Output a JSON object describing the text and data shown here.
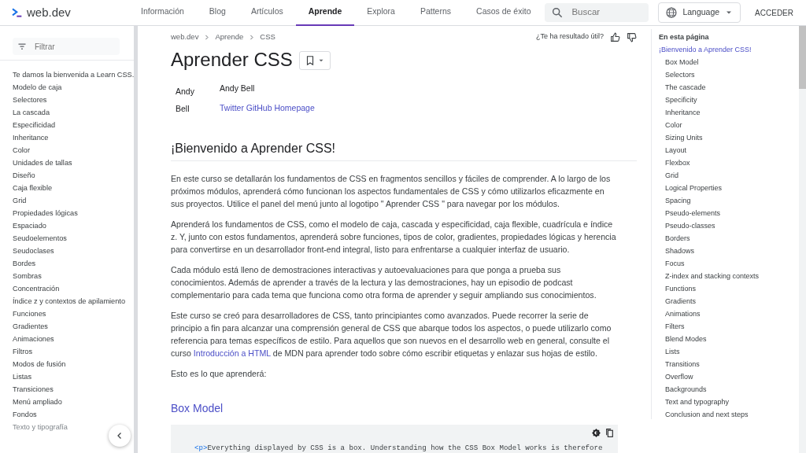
{
  "header": {
    "logo": "web.dev",
    "tabs": [
      {
        "label": "Información",
        "selected": false
      },
      {
        "label": "Blog",
        "selected": false
      },
      {
        "label": "Artículos",
        "selected": false
      },
      {
        "label": "Aprende",
        "selected": true
      },
      {
        "label": "Explora",
        "selected": false
      },
      {
        "label": "Patterns",
        "selected": false
      },
      {
        "label": "Casos de éxito",
        "selected": false
      }
    ],
    "search": {
      "placeholder": "Buscar"
    },
    "language": "Language",
    "signin": "ACCEDER"
  },
  "sidebar": {
    "filter": {
      "placeholder": "Filtrar"
    },
    "items": [
      {
        "label": "Te damos la bienvenida a Learn CSS.",
        "faded": false
      },
      {
        "label": "Modelo de caja",
        "faded": false
      },
      {
        "label": "Selectores",
        "faded": false
      },
      {
        "label": "La cascada",
        "faded": false
      },
      {
        "label": "Especificidad",
        "faded": false
      },
      {
        "label": "Inheritance",
        "faded": false
      },
      {
        "label": "Color",
        "faded": false
      },
      {
        "label": "Unidades de tallas",
        "faded": false
      },
      {
        "label": "Diseño",
        "faded": false
      },
      {
        "label": "Caja flexible",
        "faded": false
      },
      {
        "label": "Grid",
        "faded": false
      },
      {
        "label": "Propiedades lógicas",
        "faded": false
      },
      {
        "label": "Espaciado",
        "faded": false
      },
      {
        "label": "Seudoelementos",
        "faded": false
      },
      {
        "label": "Seudoclases",
        "faded": false
      },
      {
        "label": "Bordes",
        "faded": false
      },
      {
        "label": "Sombras",
        "faded": false
      },
      {
        "label": "Concentración",
        "faded": false
      },
      {
        "label": "Índice z y contextos de apilamiento",
        "faded": false
      },
      {
        "label": "Funciones",
        "faded": false
      },
      {
        "label": "Gradientes",
        "faded": false
      },
      {
        "label": "Animaciones",
        "faded": false
      },
      {
        "label": "Filtros",
        "faded": false
      },
      {
        "label": "Modos de fusión",
        "faded": false
      },
      {
        "label": "Listas",
        "faded": false
      },
      {
        "label": "Transiciones",
        "faded": false
      },
      {
        "label": "Menú ampliado",
        "faded": false
      },
      {
        "label": "Fondos",
        "faded": false
      },
      {
        "label": "Texto y tipografía",
        "faded": true
      }
    ]
  },
  "breadcrumbs": [
    "web.dev",
    "Aprende",
    "CSS"
  ],
  "feedback": "¿Te ha resultado útil?",
  "title": "Aprender CSS",
  "author": {
    "image_alt": "Andy Bell",
    "name": "Andy Bell",
    "links": "Twitter GitHub Homepage"
  },
  "section_heading": "¡Bienvenido a Aprender CSS!",
  "paragraphs": [
    [
      {
        "kind": "text",
        "text": "En este curso se detallarán los fundamentos de CSS en fragmentos sencillos y fáciles de comprender. A lo largo de los próximos módulos, aprenderá cómo funcionan los aspectos fundamentales de CSS y cómo utilizarlos eficazmente en sus proyectos. Utilice el panel del menú junto al logotipo \" Aprender CSS \" para navegar por los módulos."
      }
    ],
    [
      {
        "kind": "text",
        "text": "Aprenderá los fundamentos de CSS, como el modelo de caja, cascada y especificidad, caja flexible, cuadrícula e índice z. Y, junto con estos fundamentos, aprenderá sobre funciones, tipos de color, gradientes, propiedades lógicas y herencia para convertirse en un desarrollador front-end integral, listo para enfrentarse a cualquier interfaz de usuario."
      }
    ],
    [
      {
        "kind": "text",
        "text": "Cada módulo está lleno de demostraciones interactivas y autoevaluaciones para que ponga a prueba sus conocimientos. Además de aprender a través de la lectura y las demostraciones, hay un episodio de podcast complementario para cada tema que funciona como otra forma de aprender y seguir ampliando sus conocimientos."
      }
    ],
    [
      {
        "kind": "text",
        "text": "Este curso se creó para desarrolladores de CSS, tanto principiantes como avanzados. Puede recorrer la serie de principio a fin para alcanzar una comprensión general de CSS que abarque todos los aspectos, o puede utilizarlo como referencia para temas específicos de estilo. Para aquellos que son nuevos en el desarrollo web en general, consulte el curso "
      },
      {
        "kind": "link",
        "text": "Introducción a HTML"
      },
      {
        "kind": "text",
        "text": " de MDN para aprender todo sobre cómo escribir etiquetas y enlazar sus hojas de estilo."
      }
    ],
    [
      {
        "kind": "text",
        "text": "Esto es lo que aprenderá:"
      }
    ]
  ],
  "subheading": "Box Model",
  "code": {
    "tag": "<p>",
    "text": "Everything displayed by CSS is a box. Understanding how the CSS Box Model works is therefore"
  },
  "toc": {
    "title": "En esta página",
    "items": [
      {
        "label": "¡Bienvenido a Aprender CSS!",
        "selected": true,
        "children": [
          {
            "label": "Box Model",
            "selected": false
          },
          {
            "label": "Selectors",
            "selected": false
          },
          {
            "label": "The cascade",
            "selected": false
          },
          {
            "label": "Specificity",
            "selected": false
          },
          {
            "label": "Inheritance",
            "selected": false
          },
          {
            "label": "Color",
            "selected": false
          },
          {
            "label": "Sizing Units",
            "selected": false
          },
          {
            "label": "Layout",
            "selected": false
          },
          {
            "label": "Flexbox",
            "selected": false
          },
          {
            "label": "Grid",
            "selected": false
          },
          {
            "label": "Logical Properties",
            "selected": false
          },
          {
            "label": "Spacing",
            "selected": false
          },
          {
            "label": "Pseudo-elements",
            "selected": false
          },
          {
            "label": "Pseudo-classes",
            "selected": false
          },
          {
            "label": "Borders",
            "selected": false
          },
          {
            "label": "Shadows",
            "selected": false
          },
          {
            "label": "Focus",
            "selected": false
          },
          {
            "label": "Z-index and stacking contexts",
            "selected": false
          },
          {
            "label": "Functions",
            "selected": false
          },
          {
            "label": "Gradients",
            "selected": false
          },
          {
            "label": "Animations",
            "selected": false
          },
          {
            "label": "Filters",
            "selected": false
          },
          {
            "label": "Blend Modes",
            "selected": false
          },
          {
            "label": "Lists",
            "selected": false
          },
          {
            "label": "Transitions",
            "selected": false
          },
          {
            "label": "Overflow",
            "selected": false
          },
          {
            "label": "Backgrounds",
            "selected": false
          },
          {
            "label": "Text and typography",
            "selected": false
          },
          {
            "label": "Conclusion and next steps",
            "selected": false
          }
        ]
      }
    ]
  }
}
